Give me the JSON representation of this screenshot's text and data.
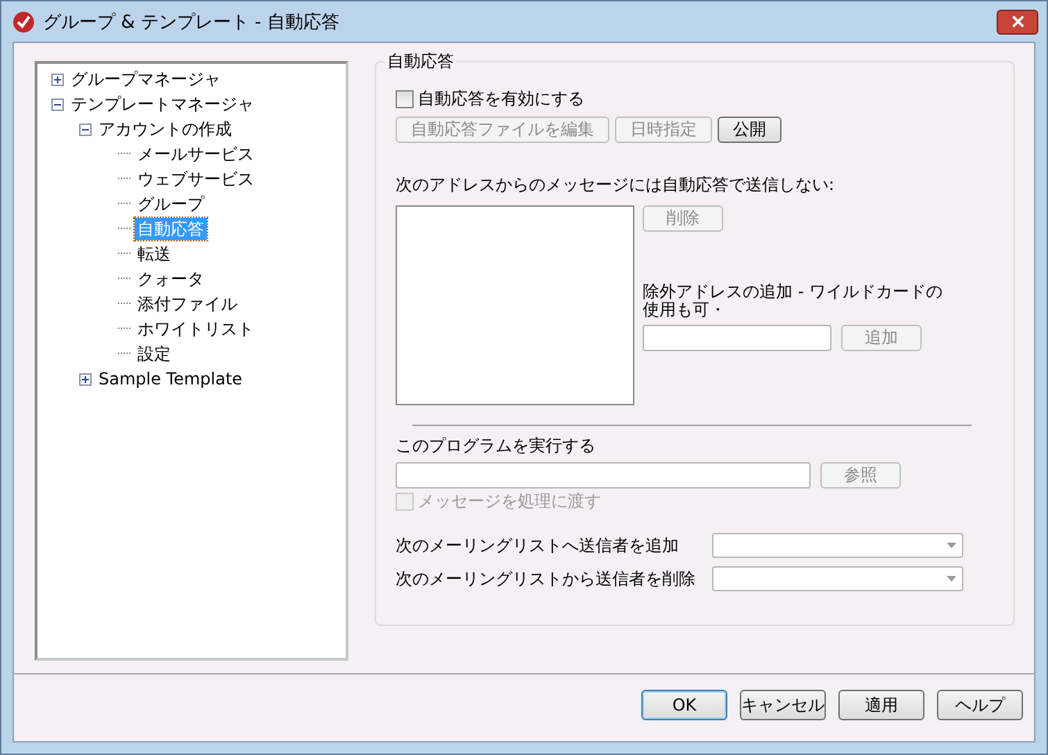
{
  "window": {
    "title": "グループ & テンプレート - 自動応答"
  },
  "tree": [
    {
      "label": "グループマネージャ",
      "expanded": false,
      "selected": false
    },
    {
      "label": "テンプレートマネージャ",
      "expanded": true,
      "selected": false,
      "children": [
        {
          "label": "アカウントの作成",
          "expanded": true,
          "selected": false,
          "children": [
            {
              "label": "メールサービス",
              "selected": false
            },
            {
              "label": "ウェブサービス",
              "selected": false
            },
            {
              "label": "グループ",
              "selected": false
            },
            {
              "label": "自動応答",
              "selected": true
            },
            {
              "label": "転送",
              "selected": false
            },
            {
              "label": "クォータ",
              "selected": false
            },
            {
              "label": "添付ファイル",
              "selected": false
            },
            {
              "label": "ホワイトリスト",
              "selected": false
            },
            {
              "label": "設定",
              "selected": false
            }
          ]
        },
        {
          "label": "Sample Template",
          "expanded": false,
          "selected": false
        }
      ]
    }
  ],
  "group": {
    "title": "自動応答",
    "enable": {
      "label": "自動応答を有効にする",
      "checked": false
    },
    "top_buttons": [
      {
        "label": "自動応答ファイルを編集",
        "disabled": true
      },
      {
        "label": "日時指定",
        "disabled": true
      },
      {
        "label": "公開",
        "disabled": false
      }
    ],
    "exclude_label": "次のアドレスからのメッセージには自動応答で送信しない:",
    "remove_button": {
      "label": "削除",
      "disabled": true
    },
    "add_hint": "除外アドレスの追加 - ワイルドカードの使用も可・",
    "add_button": {
      "label": "追加",
      "disabled": true
    },
    "program_label": "このプログラムを実行する",
    "browse_button": {
      "label": "参照",
      "disabled": true
    },
    "pass_message": {
      "label": "メッセージを処理に渡す",
      "checked": false,
      "disabled": true
    },
    "list_rows": [
      {
        "label": "次のメーリングリストへ送信者を追加"
      },
      {
        "label": "次のメーリングリストから送信者を削除"
      }
    ]
  },
  "buttons": [
    {
      "label": "OK",
      "default": true
    },
    {
      "label": "キャンセル",
      "default": false
    },
    {
      "label": "適用",
      "default": false
    },
    {
      "label": "ヘルプ",
      "default": false
    }
  ]
}
